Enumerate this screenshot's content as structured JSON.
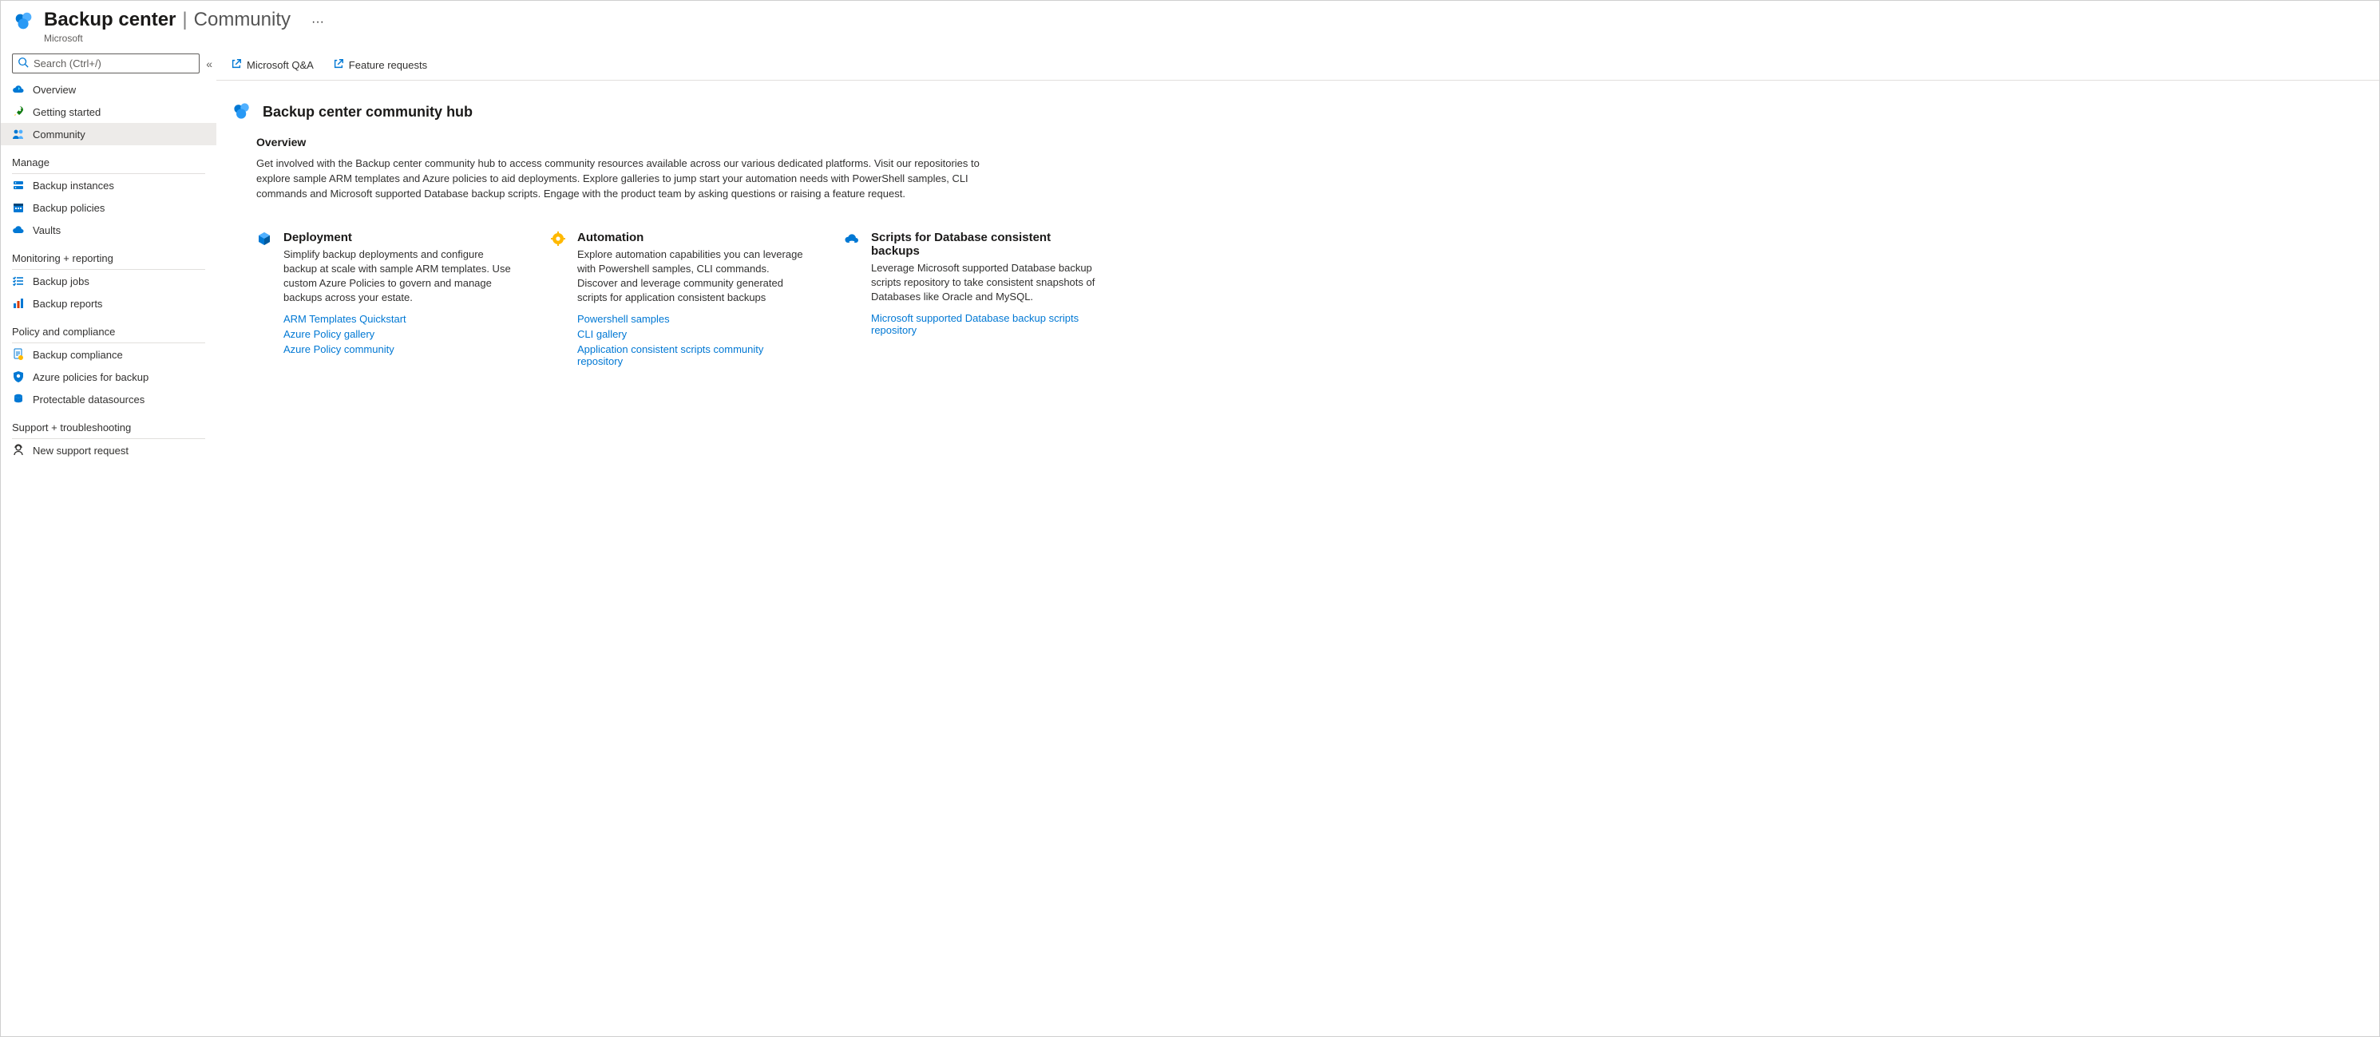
{
  "header": {
    "title_main": "Backup center",
    "title_sep": "|",
    "title_sub": "Community",
    "ellipsis": "···",
    "service": "Microsoft"
  },
  "sidebar": {
    "search_placeholder": "Search (Ctrl+/)",
    "top_items": [
      {
        "id": "overview",
        "label": "Overview",
        "icon": "cloud-sync"
      },
      {
        "id": "getting-started",
        "label": "Getting started",
        "icon": "rocket"
      },
      {
        "id": "community",
        "label": "Community",
        "icon": "people"
      }
    ],
    "sections": [
      {
        "label": "Manage",
        "items": [
          {
            "id": "backup-instances",
            "label": "Backup instances",
            "icon": "server"
          },
          {
            "id": "backup-policies",
            "label": "Backup policies",
            "icon": "calendar"
          },
          {
            "id": "vaults",
            "label": "Vaults",
            "icon": "cloud-vault"
          }
        ]
      },
      {
        "label": "Monitoring + reporting",
        "items": [
          {
            "id": "backup-jobs",
            "label": "Backup jobs",
            "icon": "list-check"
          },
          {
            "id": "backup-reports",
            "label": "Backup reports",
            "icon": "bar-chart"
          }
        ]
      },
      {
        "label": "Policy and compliance",
        "items": [
          {
            "id": "backup-compliance",
            "label": "Backup compliance",
            "icon": "compliance-doc"
          },
          {
            "id": "azure-policies-backup",
            "label": "Azure policies for backup",
            "icon": "shield-gear"
          },
          {
            "id": "protectable-datasources",
            "label": "Protectable datasources",
            "icon": "datasource"
          }
        ]
      },
      {
        "label": "Support + troubleshooting",
        "items": [
          {
            "id": "new-support-request",
            "label": "New support request",
            "icon": "support-person"
          }
        ]
      }
    ],
    "selected": "community"
  },
  "command_bar": {
    "links": [
      {
        "id": "microsoft-qa",
        "label": "Microsoft Q&A"
      },
      {
        "id": "feature-requests",
        "label": "Feature requests"
      }
    ]
  },
  "hub": {
    "title": "Backup center community hub",
    "overview_heading": "Overview",
    "overview_text": "Get involved with the Backup center community hub to access community resources available across our various dedicated platforms. Visit our repositories to explore sample ARM templates and Azure policies to aid deployments. Explore galleries to jump start your automation needs with PowerShell samples, CLI commands and Microsoft supported Database backup scripts. Engage with the product team by asking questions or raising a feature request.",
    "cards": [
      {
        "id": "deployment",
        "icon": "cube",
        "color": "#0078d4",
        "title": "Deployment",
        "desc": "Simplify backup deployments and configure backup at scale with sample ARM templates. Use custom Azure Policies to govern and manage backups across your estate.",
        "links": [
          {
            "label": "ARM Templates Quickstart"
          },
          {
            "label": "Azure Policy gallery"
          },
          {
            "label": "Azure Policy community"
          }
        ]
      },
      {
        "id": "automation",
        "icon": "gear",
        "color": "#f2a900",
        "title": "Automation",
        "desc": "Explore automation capabilities you can leverage with Powershell samples, CLI commands. Discover and leverage community generated scripts for application consistent backups",
        "links": [
          {
            "label": "Powershell samples"
          },
          {
            "label": "CLI gallery"
          },
          {
            "label": "Application consistent scripts community repository"
          }
        ]
      },
      {
        "id": "scripts-db",
        "icon": "cloud-db",
        "color": "#0078d4",
        "title": "Scripts for Database consistent backups",
        "desc": "Leverage Microsoft supported Database backup scripts repository to take consistent snapshots of Databases like Oracle and MySQL.",
        "links": [
          {
            "label": "Microsoft supported Database backup scripts repository"
          }
        ]
      }
    ]
  }
}
